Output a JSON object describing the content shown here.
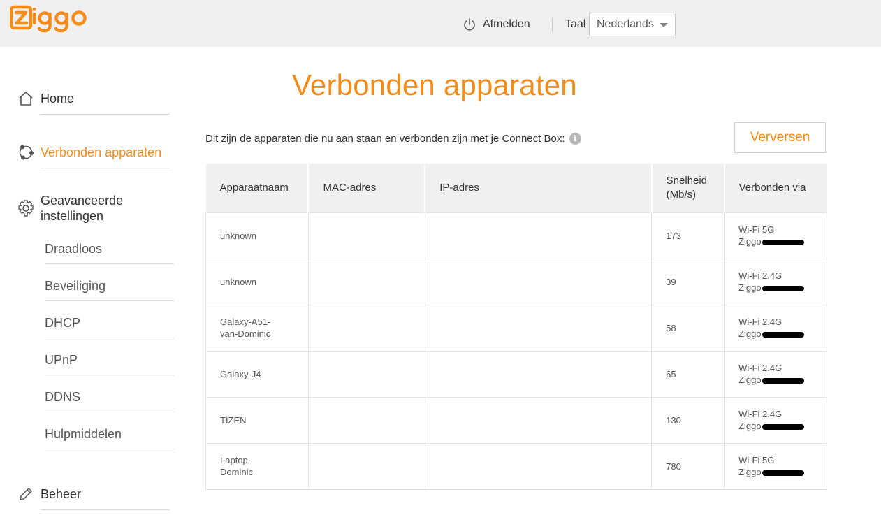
{
  "header": {
    "logo_text": "ziggo",
    "logout_label": "Afmelden",
    "language_label": "Taal",
    "language_selected": "Nederlands"
  },
  "sidebar": {
    "home": "Home",
    "connected_devices": "Verbonden apparaten",
    "advanced_settings": "Geavanceerde instellingen",
    "sub_items": [
      "Draadloos",
      "Beveiliging",
      "DHCP",
      "UPnP",
      "DDNS",
      "Hulpmiddelen"
    ],
    "management": "Beheer"
  },
  "main": {
    "title": "Verbonden apparaten",
    "intro": "Dit zijn de apparaten die nu aan staan en verbonden zijn met je Connect Box:",
    "refresh_label": "Verversen",
    "columns": [
      "Apparaatnaam",
      "MAC-adres",
      "IP-adres",
      "Snelheid (Mb/s)",
      "Verbonden via"
    ],
    "rows": [
      {
        "name": "unknown",
        "mac": "",
        "ip": "",
        "speed": "173",
        "via_band": "Wi-Fi 5G",
        "via_network": "Ziggo"
      },
      {
        "name": "unknown",
        "mac": "",
        "ip": "",
        "speed": "39",
        "via_band": "Wi-Fi 2.4G",
        "via_network": "Ziggo"
      },
      {
        "name": "Galaxy-A51-van-Dominic",
        "mac": "",
        "ip": "",
        "speed": "58",
        "via_band": "Wi-Fi 2.4G",
        "via_network": "Ziggo"
      },
      {
        "name": "Galaxy-J4",
        "mac": "",
        "ip": "",
        "speed": "65",
        "via_band": "Wi-Fi 2.4G",
        "via_network": "Ziggo"
      },
      {
        "name": "TIZEN",
        "mac": "",
        "ip": "",
        "speed": "130",
        "via_band": "Wi-Fi 2.4G",
        "via_network": "Ziggo"
      },
      {
        "name": "Laptop-Dominic",
        "mac": "",
        "ip": "",
        "speed": "780",
        "via_band": "Wi-Fi 5G",
        "via_network": "Ziggo"
      }
    ]
  },
  "colors": {
    "accent": "#f48c1a",
    "header_bg": "#f0f0f0",
    "table_header_bg": "#f0f0f0"
  },
  "icons": [
    "power-icon",
    "home-icon",
    "devices-icon",
    "gear-icon",
    "pencil-icon",
    "info-icon",
    "chevron-down-icon"
  ]
}
